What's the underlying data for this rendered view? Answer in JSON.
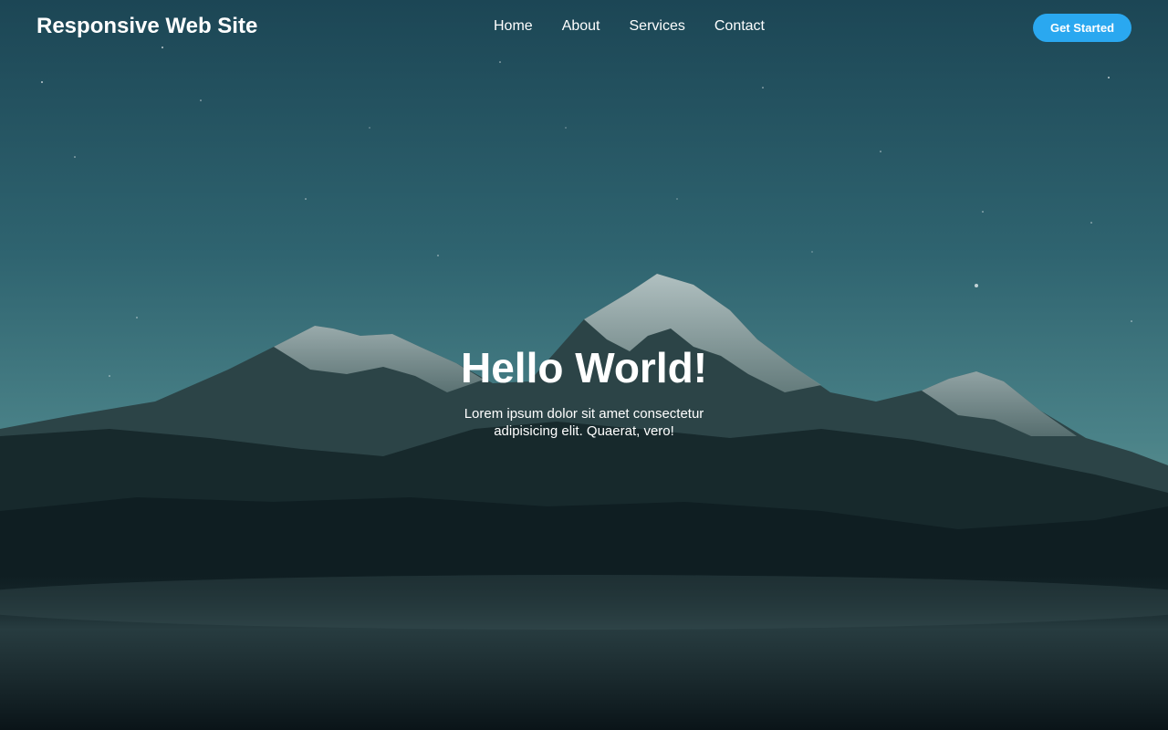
{
  "site": {
    "logo": "Responsive Web Site"
  },
  "nav": {
    "items": [
      {
        "label": "Home"
      },
      {
        "label": "About"
      },
      {
        "label": "Services"
      },
      {
        "label": "Contact"
      }
    ],
    "cta_label": "Get Started"
  },
  "hero": {
    "title": "Hello World!",
    "text": "Lorem ipsum dolor sit amet consectetur adipisicing elit. Quaerat, vero!"
  },
  "colors": {
    "accent": "#2aa8f0",
    "text": "#ffffff",
    "sky_top": "#1f4a5a",
    "sky_horizon": "#4d868c",
    "foreground": "#071216"
  }
}
